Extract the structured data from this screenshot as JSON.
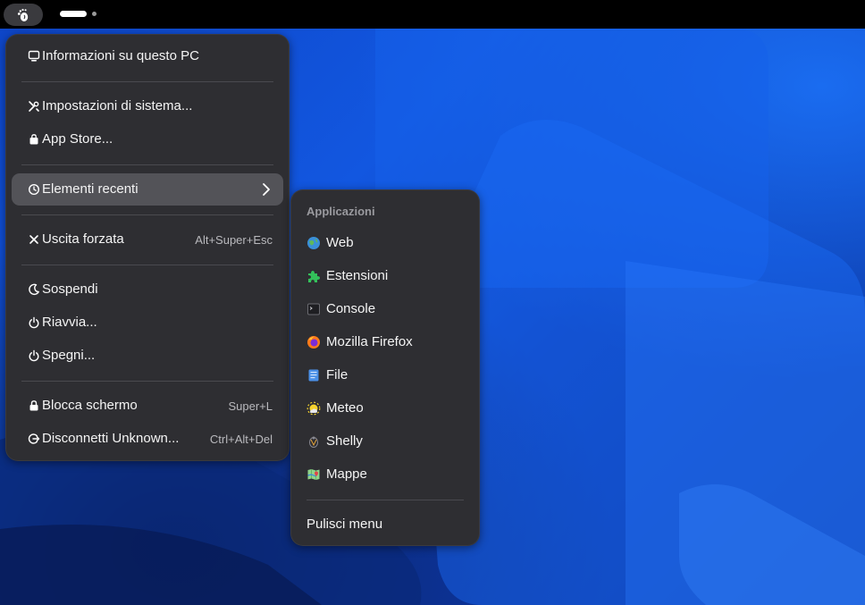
{
  "topbar": {
    "activities_icon": "gnome-foot-icon",
    "workspaces": [
      {
        "active": true
      },
      {
        "active": false
      }
    ]
  },
  "main_menu": {
    "items": [
      {
        "label": "Informazioni su questo PC",
        "icon": "monitor-icon"
      },
      {
        "label": "Impostazioni di sistema...",
        "icon": "tools-icon"
      },
      {
        "label": "App Store...",
        "icon": "bag-icon"
      },
      {
        "label": "Elementi recenti",
        "icon": "clock-icon",
        "submenu": true
      },
      {
        "label": "Uscita forzata",
        "icon": "close-icon",
        "accel": "Alt+Super+Esc"
      },
      {
        "label": "Sospendi",
        "icon": "moon-icon"
      },
      {
        "label": "Riavvia...",
        "icon": "power-icon"
      },
      {
        "label": "Spegni...",
        "icon": "power-icon"
      },
      {
        "label": "Blocca schermo",
        "icon": "lock-icon",
        "accel": "Super+L"
      },
      {
        "label": "Disconnetti Unknown...",
        "icon": "logout-icon",
        "accel": "Ctrl+Alt+Del"
      }
    ]
  },
  "recent_menu": {
    "header": "Applicazioni",
    "items": [
      {
        "label": "Web",
        "icon": "web-browser-icon"
      },
      {
        "label": "Estensioni",
        "icon": "puzzle-icon"
      },
      {
        "label": "Console",
        "icon": "terminal-icon"
      },
      {
        "label": "Mozilla Firefox",
        "icon": "firefox-icon"
      },
      {
        "label": "File",
        "icon": "files-icon"
      },
      {
        "label": "Meteo",
        "icon": "weather-icon"
      },
      {
        "label": "Shelly",
        "icon": "shelly-icon"
      },
      {
        "label": "Mappe",
        "icon": "maps-icon"
      }
    ],
    "clear_label": "Pulisci menu"
  },
  "colors": {
    "menu_bg": "#2e2e32",
    "highlight": "#535358",
    "wallpaper_blue": "#1257e0"
  }
}
